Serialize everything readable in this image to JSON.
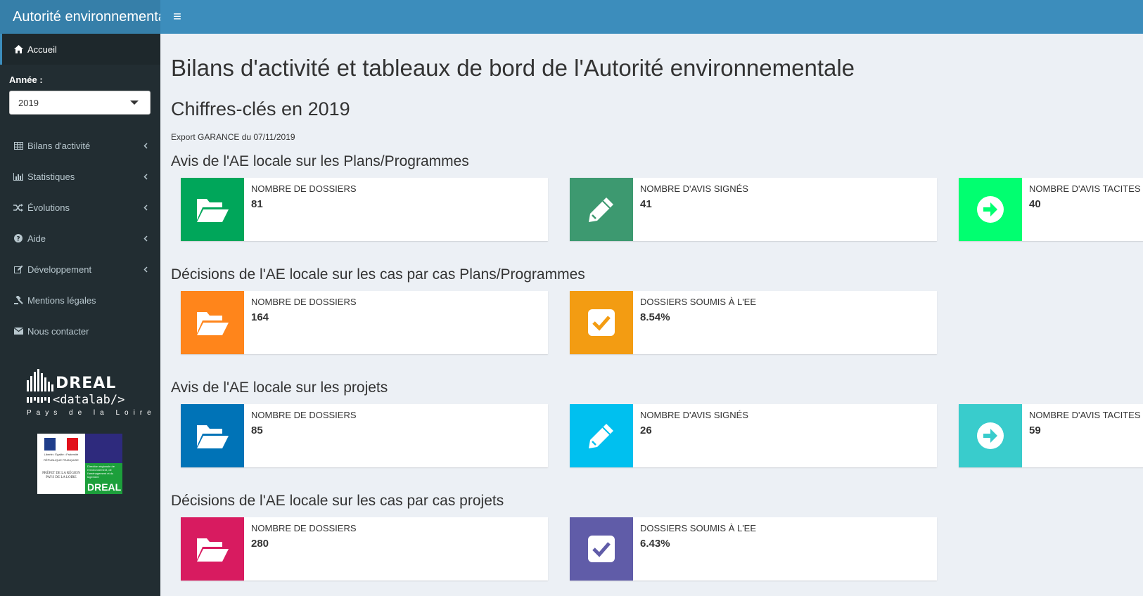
{
  "header": {
    "app_title": "Autorité environnementale en Pays de la Loire",
    "toggle_icon": "hamburger-icon",
    "toggle_glyph": "≡"
  },
  "sidebar": {
    "active_item": {
      "label": "Accueil",
      "icon": "home-icon"
    },
    "year_label": "Année :",
    "year_value": "2019",
    "items": [
      {
        "label": "Bilans d'activité",
        "icon": "table-icon",
        "has_submenu": true
      },
      {
        "label": "Statistiques",
        "icon": "bar-chart-icon",
        "has_submenu": true
      },
      {
        "label": "Évolutions",
        "icon": "random-icon",
        "has_submenu": true
      },
      {
        "label": "Aide",
        "icon": "question-circle-icon",
        "has_submenu": true
      },
      {
        "label": "Développement",
        "icon": "edit-icon",
        "has_submenu": true
      },
      {
        "label": "Mentions légales",
        "icon": "gavel-icon",
        "has_submenu": false
      },
      {
        "label": "Nous contacter",
        "icon": "envelope-icon",
        "has_submenu": false
      }
    ],
    "dreal_logo": {
      "title": "DREAL",
      "subtitle": "<datalab/>",
      "region": "Pays de la Loire"
    },
    "prefet_logo": {
      "rf_line1": "Liberté • Égalité • Fraternité",
      "rf_line2": "RÉPUBLIQUE FRANÇAISE",
      "prefet_text": "PRÉFET DE LA RÉGION PAYS DE LA LOIRE",
      "dreal_desc": "Direction régionale de l'environnement, de l'aménagement et du logement",
      "dreal_mark": "DREAL"
    }
  },
  "main": {
    "title": "Bilans d'activité et tableaux de bord de l'Autorité environnementale",
    "subtitle": "Chiffres-clés en 2019",
    "export_note": "Export GARANCE du 07/11/2019",
    "sections": [
      {
        "title": "Avis de l'AE locale sur les Plans/Programmes",
        "boxes": [
          {
            "label": "NOMBRE DE DOSSIERS",
            "value": "81",
            "icon": "folder-open-icon",
            "color": "#00a65a"
          },
          {
            "label": "NOMBRE D'AVIS SIGNÉS",
            "value": "41",
            "icon": "pencil-icon",
            "color": "#3d9970"
          },
          {
            "label": "NOMBRE D'AVIS TACITES",
            "value": "40",
            "icon": "arrow-circle-right-icon",
            "color": "#01ff70"
          }
        ]
      },
      {
        "title": "Décisions de l'AE locale sur les cas par cas Plans/Programmes",
        "boxes": [
          {
            "label": "NOMBRE DE DOSSIERS",
            "value": "164",
            "icon": "folder-open-icon",
            "color": "#ff851b"
          },
          {
            "label": "DOSSIERS SOUMIS À L'EE",
            "value": "8.54%",
            "icon": "check-square-icon",
            "color": "#f39c12"
          }
        ]
      },
      {
        "title": "Avis de l'AE locale sur les projets",
        "boxes": [
          {
            "label": "NOMBRE DE DOSSIERS",
            "value": "85",
            "icon": "folder-open-icon",
            "color": "#0073b7"
          },
          {
            "label": "NOMBRE D'AVIS SIGNÉS",
            "value": "26",
            "icon": "pencil-icon",
            "color": "#00c0ef"
          },
          {
            "label": "NOMBRE D'AVIS TACITES",
            "value": "59",
            "icon": "arrow-circle-right-icon",
            "color": "#39cccc"
          }
        ]
      },
      {
        "title": "Décisions de l'AE locale sur les cas par cas projets",
        "boxes": [
          {
            "label": "NOMBRE DE DOSSIERS",
            "value": "280",
            "icon": "folder-open-icon",
            "color": "#d81b60"
          },
          {
            "label": "DOSSIERS SOUMIS À L'EE",
            "value": "6.43%",
            "icon": "check-square-icon",
            "color": "#605ca8"
          }
        ]
      }
    ]
  }
}
